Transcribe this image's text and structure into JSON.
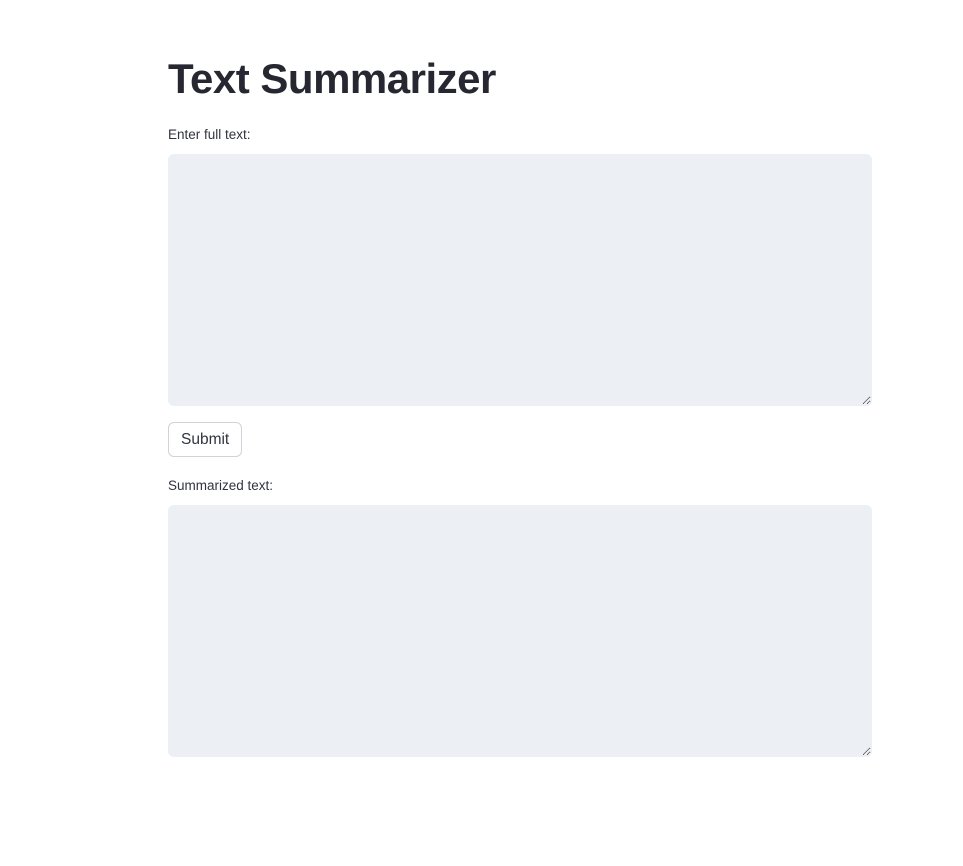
{
  "page": {
    "title": "Text Summarizer"
  },
  "input": {
    "label": "Enter full text:",
    "value": "",
    "placeholder": ""
  },
  "actions": {
    "submit_label": "Submit"
  },
  "output": {
    "label": "Summarized text:",
    "value": "",
    "placeholder": ""
  },
  "colors": {
    "text": "#262730",
    "textarea_bg": "#eceff4",
    "button_border": "#d0d3da"
  }
}
